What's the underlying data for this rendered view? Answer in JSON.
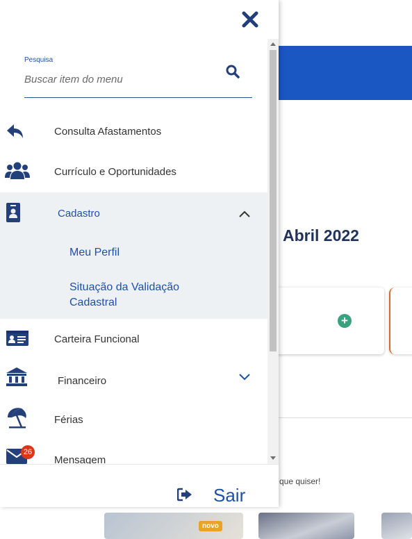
{
  "drawer": {
    "search": {
      "label": "Pesquisa",
      "placeholder": "Buscar item do menu"
    },
    "menu": [
      {
        "label": "Consulta Afastamentos",
        "icon": "reply-arrow-icon"
      },
      {
        "label": "Currículo e Oportunidades",
        "icon": "users-icon"
      },
      {
        "label": "Cadastro",
        "icon": "id-badge-icon",
        "expanded": true,
        "children": [
          "Meu Perfil",
          "Situação da Validação Cadastral"
        ]
      },
      {
        "label": "Carteira Funcional",
        "icon": "id-card-icon"
      },
      {
        "label": "Financeiro",
        "icon": "bank-icon",
        "expanded": false
      },
      {
        "label": "Férias",
        "icon": "beach-umbrella-icon"
      },
      {
        "label": "Mensagem",
        "icon": "envelope-icon",
        "badge": "26"
      }
    ],
    "logout_label": "Sair"
  },
  "background": {
    "heading": "Abril 2022",
    "tagline": "que quiser!",
    "badge_new": "novo"
  },
  "colors": {
    "accent": "#1f4fa7",
    "header_blue": "#1a57c2",
    "icon_navy": "#23407a",
    "badge_red": "#d9361a"
  }
}
